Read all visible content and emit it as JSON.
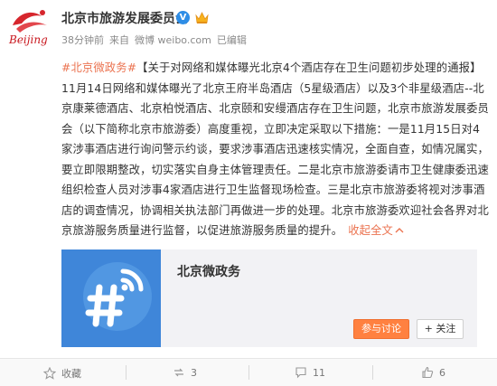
{
  "account": {
    "name": "北京市旅游发展委员会",
    "verified_badge": "V",
    "logo_text": "Beijing",
    "time": "38分钟前",
    "source_prefix": "来自",
    "source": "微博 weibo.com",
    "edited": "已编辑"
  },
  "post": {
    "topic": "#北京微政务#",
    "body": "【关于对网络和媒体曝光北京4个酒店存在卫生问题初步处理的通报】11月14日网络和媒体曝光了北京王府半岛酒店（5星级酒店）以及3个非星级酒店--北京康莱德酒店、北京柏悦酒店、北京颐和安缦酒店存在卫生问题，北京市旅游发展委员会（以下简称北京市旅游委）高度重视，立即决定采取以下措施：一是11月15日对4家涉事酒店进行询问警示约谈，要求涉事酒店迅速核实情况，全面自查，如情况属实，要立即限期整改，切实落实自身主体管理责任。二是北京市旅游委请市卫生健康委迅速组织检查人员对涉事4家酒店进行卫生监督现场检查。三是北京市旅游委将视对涉事酒店的调查情况，协调相关执法部门再做进一步的处理。北京市旅游委欢迎社会各界对北京旅游服务质量进行监督，以促进旅游服务质量的提升。",
    "fold_label": "收起全文",
    "fold_icon": "chevron-up-icon"
  },
  "card": {
    "title": "北京微政务",
    "discuss_label": "参与讨论",
    "follow_label": "+ 关注",
    "thumb_color": "#3f86d9"
  },
  "actions": {
    "favorite_label": "收藏",
    "repost_count": "3",
    "comment_count": "11",
    "like_count": "6"
  },
  "colors": {
    "accent": "#eb7350",
    "button_orange": "#ff8140",
    "verified_blue": "#2e8de6"
  }
}
